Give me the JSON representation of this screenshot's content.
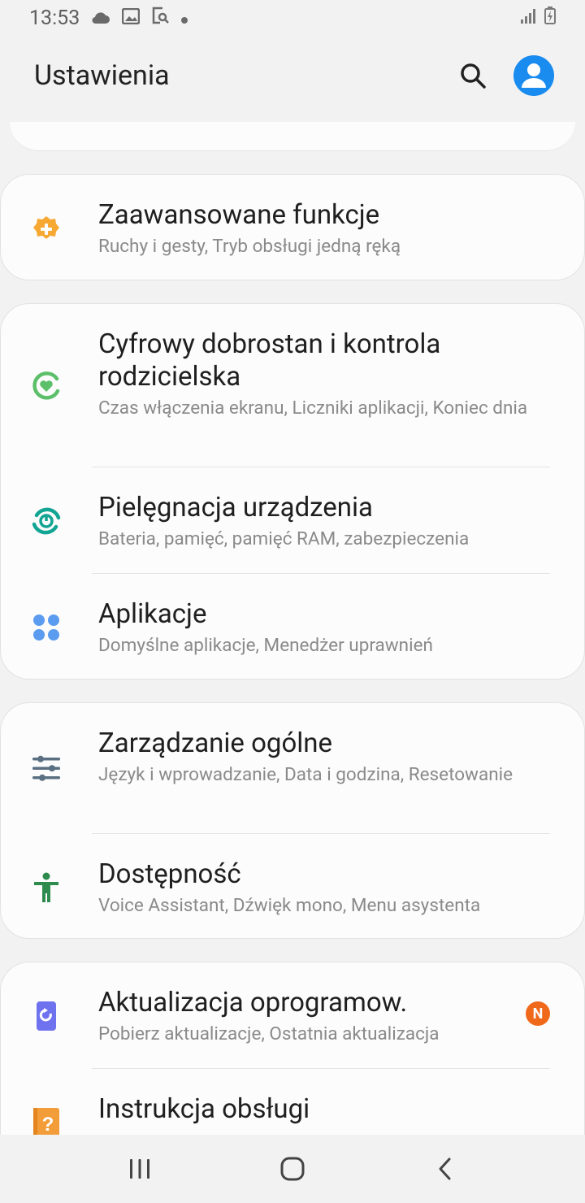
{
  "status_bar": {
    "time": "13:53"
  },
  "header": {
    "title": "Ustawienia"
  },
  "cards": [
    {
      "items": [
        {
          "title": "Zaawansowane funkcje",
          "subtitle": "Ruchy i gesty, Tryb obsługi jedną ręką",
          "icon": "gear-plus-icon"
        }
      ]
    },
    {
      "items": [
        {
          "title": "Cyfrowy dobrostan i kontrola rodzicielska",
          "subtitle": "Czas włączenia ekranu, Liczniki aplikacji, Koniec dnia",
          "icon": "heart-circle-icon"
        },
        {
          "title": "Pielęgnacja urządzenia",
          "subtitle": "Bateria, pamięć, pamięć RAM, zabezpieczenia",
          "icon": "device-care-icon"
        },
        {
          "title": "Aplikacje",
          "subtitle": "Domyślne aplikacje, Menedżer uprawnień",
          "icon": "apps-grid-icon"
        }
      ]
    },
    {
      "items": [
        {
          "title": "Zarządzanie ogólne",
          "subtitle": "Język i wprowadzanie, Data i godzina, Resetowanie",
          "icon": "sliders-icon"
        },
        {
          "title": "Dostępność",
          "subtitle": "Voice Assistant, Dźwięk mono, Menu asystenta",
          "icon": "accessibility-icon"
        }
      ]
    },
    {
      "items": [
        {
          "title": "Aktualizacja oprogramow.",
          "subtitle": "Pobierz aktualizacje, Ostatnia aktualizacja",
          "icon": "software-update-icon",
          "badge": "N"
        },
        {
          "title": "Instrukcja obsługi",
          "subtitle": "",
          "icon": "user-manual-icon"
        }
      ]
    }
  ],
  "colors": {
    "background": "#f2f2f2",
    "card": "#fcfcfc",
    "avatar": "#1a8cf0",
    "badge": "#f0681a",
    "advanced_icon": "#f7a833",
    "wellbeing_icon": "#5cbf6a",
    "device_care_icon": "#12a594",
    "apps_icon": "#5b9cf0",
    "general_icon": "#5a7082",
    "accessibility_icon": "#2e8b4e",
    "update_icon": "#6f72ef",
    "manual_icon": "#f39c3a"
  }
}
